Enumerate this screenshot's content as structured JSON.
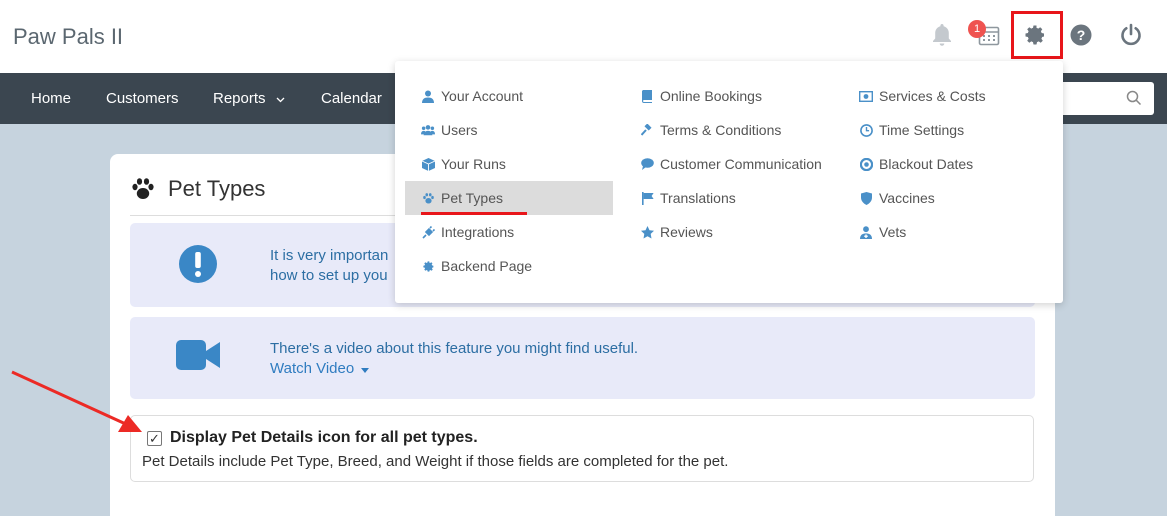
{
  "app": {
    "title": "Paw Pals II"
  },
  "header": {
    "notification_count": "1"
  },
  "nav": {
    "items": [
      "Home",
      "Customers",
      "Reports",
      "Calendar"
    ],
    "search_placeholder": ""
  },
  "page": {
    "title": "Pet Types",
    "alert_text_line1": "It is very importan",
    "alert_text_line2": "how to set up you",
    "video_text": "There's a video about this feature you might find useful.",
    "video_link": "Watch Video",
    "checkbox_label": "Display Pet Details icon for all pet types.",
    "checkbox_description": "Pet Details include Pet Type, Breed, and Weight if those fields are completed for the pet.",
    "checkbox_checked": true
  },
  "settings_menu": {
    "col1": [
      {
        "label": "Your Account",
        "icon": "user-icon"
      },
      {
        "label": "Users",
        "icon": "users-icon"
      },
      {
        "label": "Your Runs",
        "icon": "cube-icon"
      },
      {
        "label": "Pet Types",
        "icon": "paw-icon",
        "active": true
      },
      {
        "label": "Integrations",
        "icon": "plug-icon"
      },
      {
        "label": "Backend Page",
        "icon": "gear-icon"
      }
    ],
    "col2": [
      {
        "label": "Online Bookings",
        "icon": "book-icon"
      },
      {
        "label": "Terms & Conditions",
        "icon": "gavel-icon"
      },
      {
        "label": "Customer Communication",
        "icon": "comment-icon"
      },
      {
        "label": "Translations",
        "icon": "flag-icon"
      },
      {
        "label": "Reviews",
        "icon": "star-icon"
      }
    ],
    "col3": [
      {
        "label": "Services & Costs",
        "icon": "money-icon"
      },
      {
        "label": "Time Settings",
        "icon": "clock-icon"
      },
      {
        "label": "Blackout Dates",
        "icon": "circle-icon"
      },
      {
        "label": "Vaccines",
        "icon": "shield-icon"
      },
      {
        "label": "Vets",
        "icon": "doctor-icon"
      }
    ]
  },
  "colors": {
    "nav_bg": "#3b4650",
    "accent_blue": "#4a90c8",
    "highlight_red": "#e8161a",
    "page_bg": "#c6d3de",
    "alert_bg": "#e8eaf9"
  }
}
